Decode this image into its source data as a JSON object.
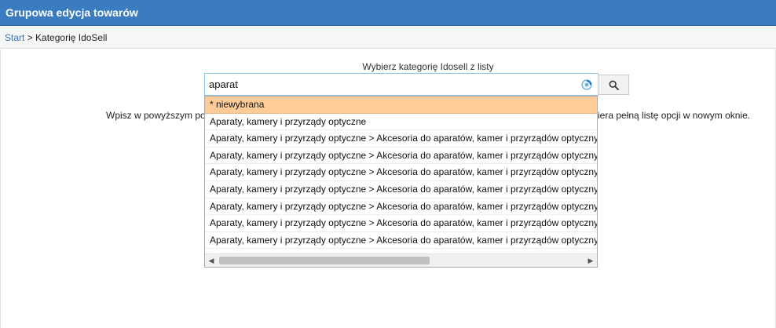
{
  "window": {
    "title": "Grupowa edycja towarów"
  },
  "breadcrumb": {
    "start": "Start",
    "separator": ">",
    "current": "Kategorię IdoSell"
  },
  "form": {
    "label": "Wybierz kategorię Idosell z listy",
    "search_value": "aparat",
    "hint_left": "Wpisz w powyższym po",
    "hint_right": "iera pełną listę opcji w nowym oknie."
  },
  "dropdown": {
    "items": [
      "* niewybrana",
      "Aparaty, kamery i przyrządy optyczne",
      "Aparaty, kamery i przyrządy optyczne > Akcesoria do aparatów, kamer i przyrządów optycznych",
      "Aparaty, kamery i przyrządy optyczne > Akcesoria do aparatów, kamer i przyrządów optycznych",
      "Aparaty, kamery i przyrządy optyczne > Akcesoria do aparatów, kamer i przyrządów optycznych",
      "Aparaty, kamery i przyrządy optyczne > Akcesoria do aparatów, kamer i przyrządów optycznych",
      "Aparaty, kamery i przyrządy optyczne > Akcesoria do aparatów, kamer i przyrządów optycznych",
      "Aparaty, kamery i przyrządy optyczne > Akcesoria do aparatów, kamer i przyrządów optycznych",
      "Aparaty, kamery i przyrządy optyczne > Akcesoria do aparatów, kamer i przyrządów optycznych"
    ],
    "selected_index": 0
  },
  "icons": {
    "search": "magnifier-icon",
    "loading": "loading-spinner-icon"
  },
  "colors": {
    "header": "#3b7cc0",
    "link": "#2f78c4",
    "selected": "#ffcc99",
    "input_border": "#8ec4e6"
  }
}
